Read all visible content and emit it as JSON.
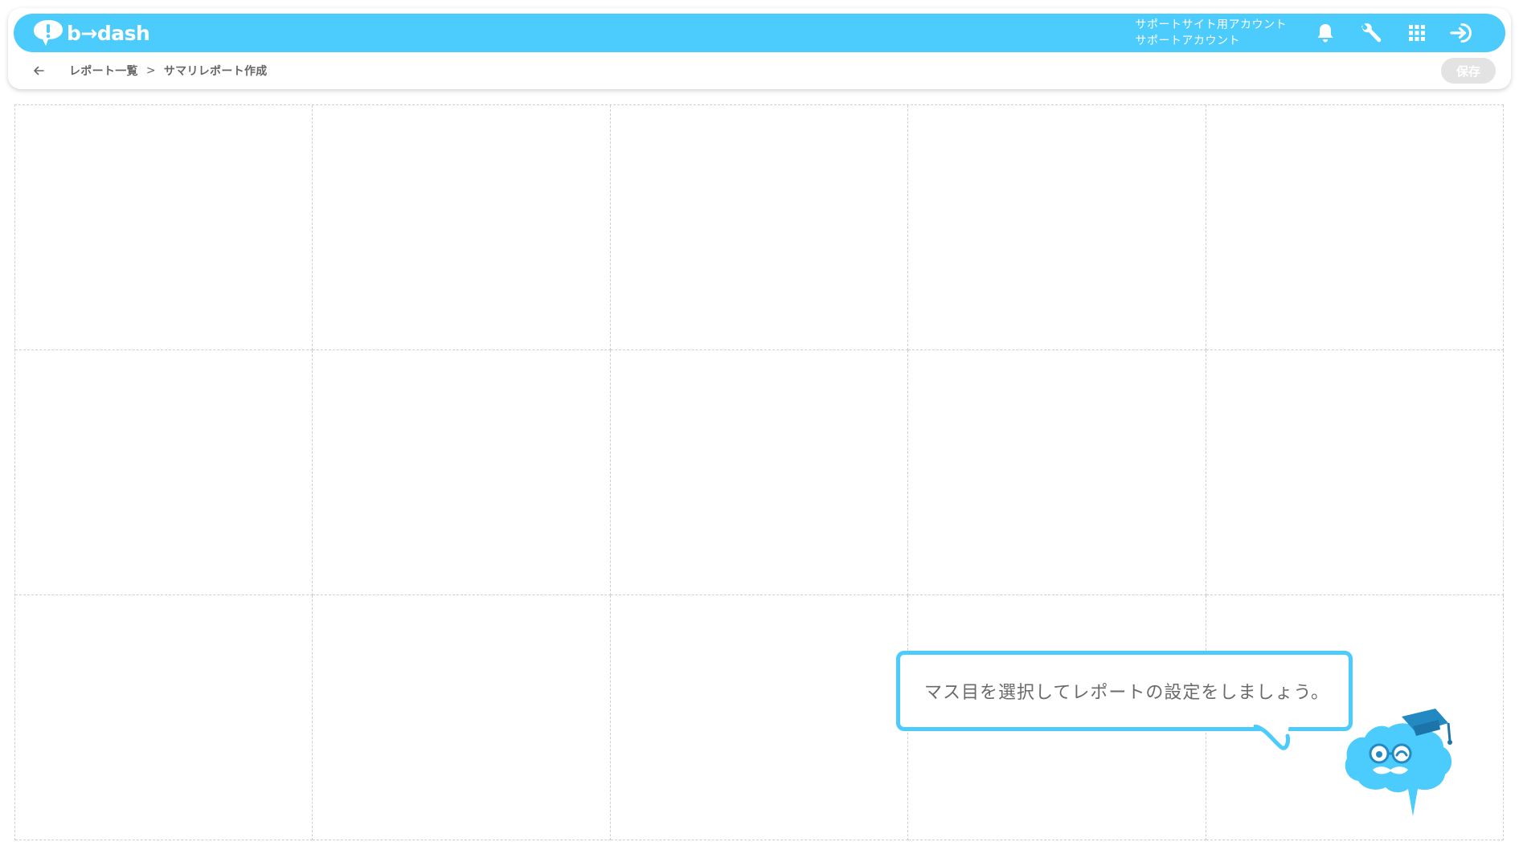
{
  "app": {
    "brand": "b→dash",
    "brand_color": "#4ccbfd"
  },
  "header": {
    "account_line1": "サポートサイト用アカウント",
    "account_line2": "サポートアカウント",
    "icons": [
      "bell-icon",
      "wrench-icon",
      "apps-grid-icon",
      "logout-icon"
    ]
  },
  "breadcrumb": {
    "parent": "レポート一覧",
    "separator": ">",
    "current": "サマリレポート作成"
  },
  "toolbar": {
    "save_label": "保存"
  },
  "grid": {
    "columns": 5,
    "rows": 3
  },
  "hint": {
    "message": "マス目を選択してレポートの設定をしましょう。"
  }
}
